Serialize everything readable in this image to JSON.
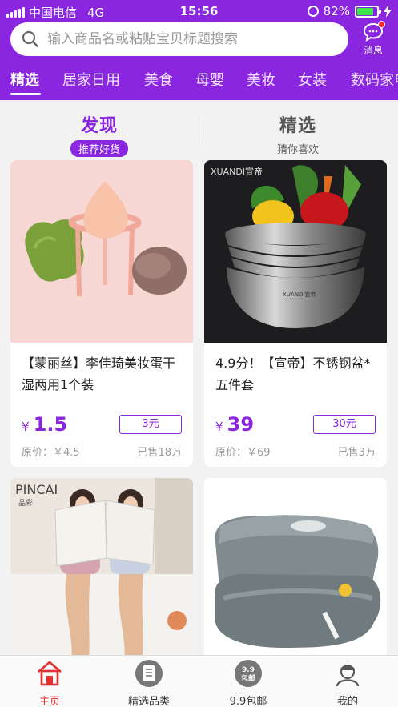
{
  "status_bar": {
    "carrier": "中国电信",
    "network": "4G",
    "time": "15:56",
    "battery": "82%",
    "battery_level": 0.82
  },
  "search": {
    "placeholder": "输入商品名或粘贴宝贝标题搜索"
  },
  "message": {
    "label": "消息"
  },
  "categories": [
    {
      "label": "精选",
      "active": true
    },
    {
      "label": "居家日用",
      "active": false
    },
    {
      "label": "美食",
      "active": false
    },
    {
      "label": "母婴",
      "active": false
    },
    {
      "label": "美妆",
      "active": false
    },
    {
      "label": "女装",
      "active": false
    },
    {
      "label": "数码家电",
      "active": false
    }
  ],
  "tabs": {
    "discover": {
      "title": "发现",
      "subtitle": "推荐好货"
    },
    "featured": {
      "title": "精选",
      "subtitle": "猜你喜欢"
    }
  },
  "products": [
    {
      "title": "【蒙丽丝】李佳琦美妆蛋干湿两用1个装",
      "currency": "¥",
      "price": "1.5",
      "coupon": "3元",
      "original": "原价：￥4.5",
      "sold": "已售18万",
      "image": "makeup-sponge-image"
    },
    {
      "title": "4.9分！【宣帝】不锈钢盆*五件套",
      "currency": "¥",
      "price": "39",
      "coupon": "30元",
      "original": "原价：￥69",
      "sold": "已售3万",
      "image": "steel-bowls-image",
      "image_brand": "XUANDI宣帝"
    },
    {
      "title": "",
      "image": "stockings-models-image",
      "image_brand": "PINCAI",
      "image_brand_cn": "品彩"
    },
    {
      "title": "",
      "image": "blanket-image"
    }
  ],
  "bottom_nav": [
    {
      "label": "主页",
      "icon": "home-icon",
      "active": true
    },
    {
      "label": "精选品类",
      "icon": "category-icon",
      "active": false
    },
    {
      "label": "9.9包邮",
      "icon": "deal-icon",
      "icon_text_top": "9.9",
      "icon_text_bottom": "包邮",
      "active": false
    },
    {
      "label": "我的",
      "icon": "profile-icon",
      "active": false
    }
  ],
  "colors": {
    "brand_purple": "#8a25e0",
    "active_red": "#e0302f",
    "battery_green": "#3ee64b"
  }
}
